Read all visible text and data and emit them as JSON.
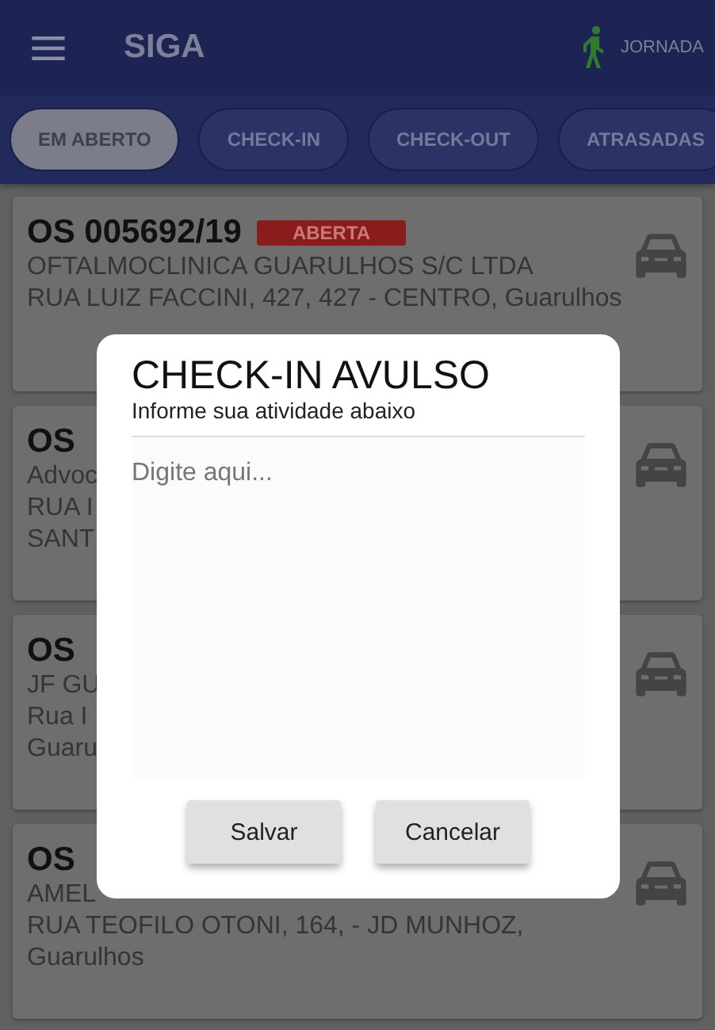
{
  "app_bar": {
    "title": "SIGA",
    "action_label": "JORNADA"
  },
  "tabs": [
    {
      "label": "EM ABERTO",
      "selected": true
    },
    {
      "label": "CHECK-IN",
      "selected": false
    },
    {
      "label": "CHECK-OUT",
      "selected": false
    },
    {
      "label": "ATRASADAS",
      "selected": false
    }
  ],
  "orders": [
    {
      "number": "OS 005692/19",
      "status": "ABERTA",
      "lines": [
        "OFTALMOCLINICA GUARULHOS S/C LTDA",
        "RUA LUIZ FACCINI, 427, 427 - CENTRO, Guarulhos"
      ]
    },
    {
      "number": "OS",
      "lines": [
        "Advoc",
        "RUA I",
        "SANT"
      ]
    },
    {
      "number": "OS",
      "lines": [
        "JF GU",
        "Rua I",
        "Guaru"
      ]
    },
    {
      "number": "OS",
      "lines": [
        "AMEL",
        "RUA TEOFILO OTONI, 164,  - JD MUNHOZ,",
        "Guarulhos"
      ]
    }
  ],
  "dialog": {
    "title": "CHECK-IN AVULSO",
    "subtitle": "Informe sua atividade abaixo",
    "field": {
      "placeholder": "Digite aqui..."
    },
    "buttons": [
      "Salvar",
      "Cancelar"
    ]
  }
}
